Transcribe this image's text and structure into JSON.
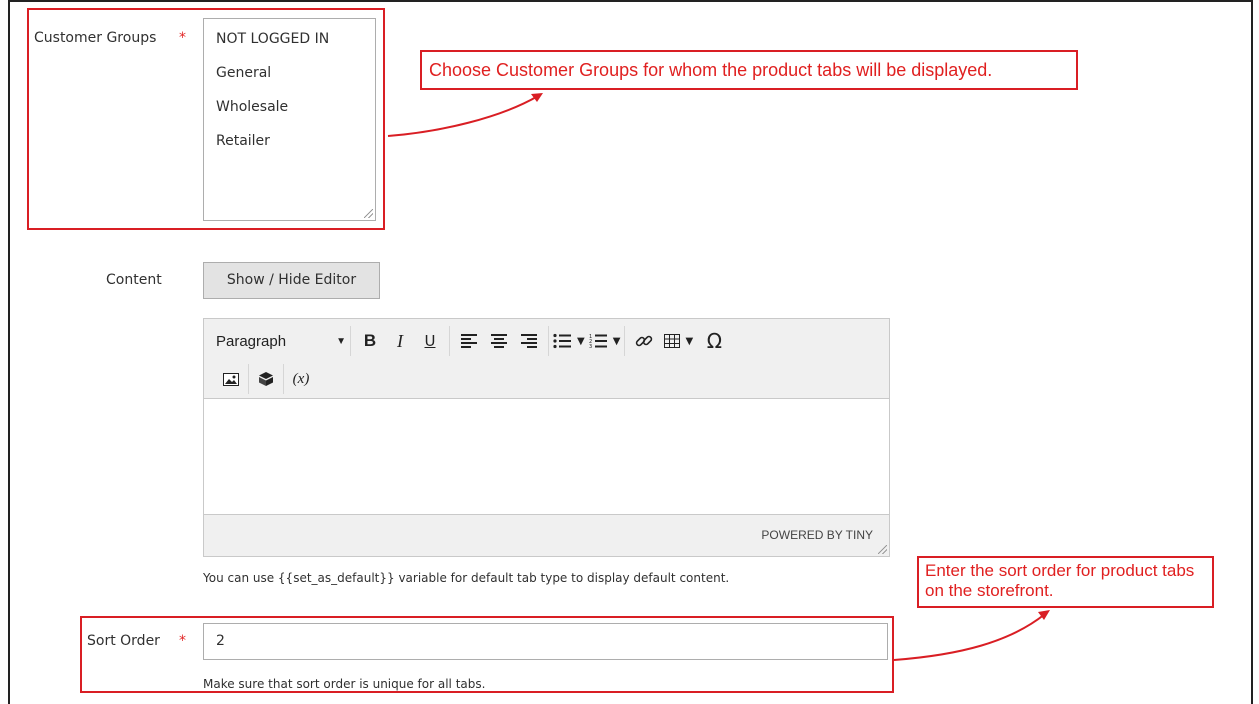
{
  "customer_groups": {
    "label": "Customer Groups",
    "required_mark": "*",
    "options": [
      "NOT LOGGED IN",
      "General",
      "Wholesale",
      "Retailer"
    ]
  },
  "content": {
    "label": "Content",
    "toggle_button": "Show / Hide Editor",
    "editor": {
      "format_select": "Paragraph",
      "toolbar_icons": [
        "bold-icon",
        "italic-icon",
        "underline-icon",
        "align-left-icon",
        "align-center-icon",
        "align-right-icon",
        "bullet-list-icon",
        "numbered-list-icon",
        "link-icon",
        "table-icon",
        "special-char-icon",
        "image-icon",
        "widget-icon",
        "variable-icon"
      ],
      "bold": "B",
      "italic": "I",
      "underline": "U",
      "omega": "Ω",
      "variable": "(x)",
      "powered_by": "POWERED BY TINY"
    },
    "note": "You can use {{set_as_default}} variable for default tab type to display default content."
  },
  "sort_order": {
    "label": "Sort Order",
    "required_mark": "*",
    "value": "2",
    "note": "Make sure that sort order is unique for all tabs."
  },
  "annotations": {
    "customer_groups_callout": "Choose Customer Groups for whom the product tabs will be displayed.",
    "sort_order_callout": "Enter the sort order for product tabs on the storefront.",
    "color": "#d91e24"
  }
}
